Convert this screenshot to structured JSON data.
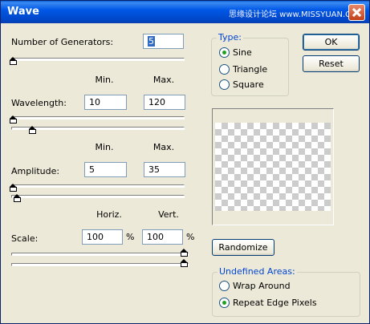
{
  "window": {
    "title": "Wave",
    "watermark": "思缘设计论坛 www.MISSYUAN.COM"
  },
  "generators": {
    "label": "Number of Generators:",
    "value": "5"
  },
  "headers": {
    "min": "Min.",
    "max": "Max.",
    "horiz": "Horiz.",
    "vert": "Vert."
  },
  "wavelength": {
    "label": "Wavelength:",
    "min": "10",
    "max": "120"
  },
  "amplitude": {
    "label": "Amplitude:",
    "min": "5",
    "max": "35"
  },
  "scale": {
    "label": "Scale:",
    "horiz": "100",
    "vert": "100",
    "unit": "%"
  },
  "type": {
    "title": "Type:",
    "options": [
      {
        "label": "Sine",
        "selected": true
      },
      {
        "label": "Triangle",
        "selected": false
      },
      {
        "label": "Square",
        "selected": false
      }
    ]
  },
  "buttons": {
    "ok": "OK",
    "reset": "Reset",
    "randomize": "Randomize"
  },
  "undefined_areas": {
    "title": "Undefined Areas:",
    "options": [
      {
        "label": "Wrap Around",
        "selected": false
      },
      {
        "label": "Repeat Edge Pixels",
        "selected": true
      }
    ]
  },
  "icons": {
    "close": "close-icon"
  },
  "colors": {
    "titlebar": "#0058e6",
    "dialog_bg": "#ece9d8",
    "group_title": "#0046d5"
  }
}
